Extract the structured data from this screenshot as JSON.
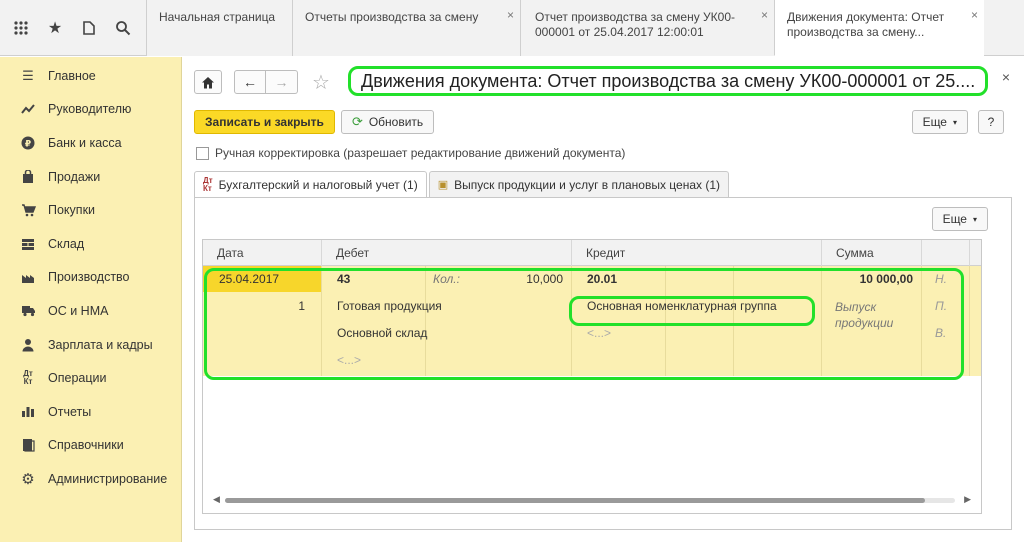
{
  "tabs": [
    {
      "label": "Начальная страница"
    },
    {
      "label": "Отчеты производства за смену"
    },
    {
      "label": "Отчет производства за смену УК00-000001 от 25.04.2017 12:00:01"
    },
    {
      "label": "Движения документа: Отчет производства за смену..."
    }
  ],
  "sidebar": {
    "items": [
      {
        "label": "Главное",
        "icon": "menu-icon"
      },
      {
        "label": "Руководителю",
        "icon": "trend-icon"
      },
      {
        "label": "Банк и касса",
        "icon": "ruble-icon"
      },
      {
        "label": "Продажи",
        "icon": "bag-icon"
      },
      {
        "label": "Покупки",
        "icon": "cart-icon"
      },
      {
        "label": "Склад",
        "icon": "warehouse-icon"
      },
      {
        "label": "Производство",
        "icon": "factory-icon"
      },
      {
        "label": "ОС и НМА",
        "icon": "truck-icon"
      },
      {
        "label": "Зарплата и кадры",
        "icon": "person-icon"
      },
      {
        "label": "Операции",
        "icon": "dtkt-icon"
      },
      {
        "label": "Отчеты",
        "icon": "barchart-icon"
      },
      {
        "label": "Справочники",
        "icon": "book-icon"
      },
      {
        "label": "Администрирование",
        "icon": "gear-icon"
      }
    ]
  },
  "document": {
    "title": "Движения документа: Отчет производства за смену УК00-000001 от 25....",
    "save_close": "Записать и закрыть",
    "refresh": "Обновить",
    "more": "Еще",
    "help": "?",
    "manual_edit": "Ручная корректировка (разрешает редактирование движений документа)",
    "form_tabs": [
      {
        "label": "Бухгалтерский и налоговый учет (1)"
      },
      {
        "label": "Выпуск продукции и услуг в плановых ценах (1)"
      }
    ],
    "table_more": "Еще"
  },
  "table": {
    "headers": {
      "date": "Дата",
      "debit": "Дебет",
      "credit": "Кредит",
      "sum": "Сумма"
    },
    "row": {
      "date": "25.04.2017",
      "num": "1",
      "debit_account": "43",
      "qty_label": "Кол.:",
      "qty": "10,000",
      "debit_sub1": "Готовая продукция",
      "debit_sub2": "Основной склад",
      "debit_sub3": "<...>",
      "credit_account": "20.01",
      "credit_sub1": "Основная номенклатурная группа",
      "credit_sub2": "<...>",
      "sum": "10 000,00",
      "sum_note": "Выпуск продукции",
      "extra1": "Н.",
      "extra2": "П.",
      "extra3": "В."
    }
  }
}
